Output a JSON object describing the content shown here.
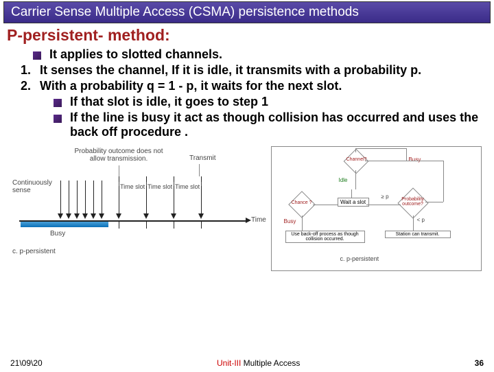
{
  "title": "Carrier Sense Multiple Access (CSMA) persistence methods",
  "subtitle": "P-persistent- method:",
  "bullets": {
    "b0": "It applies to slotted channels.",
    "n1_num": "1.",
    "n1": "It senses the channel, If it is idle, it transmits with a probability p.",
    "n2_num": "2.",
    "n2": "With a probability q = 1 - p, it waits for  the next slot.",
    "s1": "If that slot is  idle, it goes to step 1",
    "s2": "If the line is busy it act  as though collision has occurred and uses the back off procedure ."
  },
  "diagram_left": {
    "cont_sense": "Continuously sense",
    "prob_outcome": "Probability outcome does not allow transmission.",
    "transmit": "Transmit",
    "timeslot": "Time slot",
    "busy": "Busy",
    "time": "Time",
    "caption": "c. p-persistent"
  },
  "diagram_right": {
    "channel": "Channel?",
    "busy": "Busy",
    "idle": "Idle",
    "chance": "Chance ?",
    "wait_slot": "Wait a slot",
    "ge_p": "≥ p",
    "lt_p": "< p",
    "prob_outcome": "Probability outcome?",
    "backoff": "Use back-off process as though collision occurred.",
    "station_transmit": "Station can transmit.",
    "caption": "c. p-persistent"
  },
  "footer": {
    "date": "21\\09\\20",
    "unit_red": "Unit-III",
    "unit_rest": " Multiple Access",
    "page": "36"
  }
}
